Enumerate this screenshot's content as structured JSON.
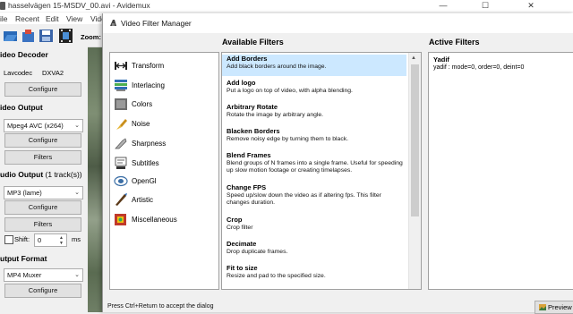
{
  "main": {
    "title": "hasselvägen 15-MSDV_00.avi - Avidemux",
    "menu": [
      "ile",
      "Recent",
      "Edit",
      "View",
      "Vide"
    ],
    "zoom_label": "Zoom:",
    "video_decoder": {
      "title": "ideo Decoder",
      "decoder_name": "Lavcodec",
      "decoder_codec": "DXVA2",
      "configure_label": "Configure"
    },
    "video_output": {
      "title": "ideo Output",
      "codec": "Mpeg4 AVC (x264)",
      "configure_label": "Configure",
      "filters_label": "Filters"
    },
    "audio_output": {
      "title": "udio Output",
      "tracks": "(1 track(s))",
      "codec": "MP3 (lame)",
      "configure_label": "Configure",
      "filters_label": "Filters",
      "shift_label": "Shift:",
      "shift_value": "0",
      "shift_unit": "ms"
    },
    "output_format": {
      "title": "utput Format",
      "muxer": "MP4 Muxer",
      "configure_label": "Configure"
    }
  },
  "dialog": {
    "title": "Video Filter Manager",
    "available_heading": "Available Filters",
    "active_heading": "Active Filters",
    "categories": [
      "Transform",
      "Interlacing",
      "Colors",
      "Noise",
      "Sharpness",
      "Subtitles",
      "OpenGl",
      "Artistic",
      "Miscellaneous"
    ],
    "available_filters": [
      {
        "name": "Add Borders",
        "desc": "Add black borders around the image."
      },
      {
        "name": "Add logo",
        "desc": "Put a logo on top of video, with alpha blending."
      },
      {
        "name": "Arbitrary Rotate",
        "desc": "Rotate the image by arbitrary angle."
      },
      {
        "name": "Blacken Borders",
        "desc": "Remove noisy edge by turning them to black."
      },
      {
        "name": "Blend Frames",
        "desc": "Blend groups of N frames into a single frame.  Useful for speeding up slow motion footage or creating timelapses."
      },
      {
        "name": "Change FPS",
        "desc": "Speed up/slow down the video as if altering fps. This filter changes duration."
      },
      {
        "name": "Crop",
        "desc": "Crop filter"
      },
      {
        "name": "Decimate",
        "desc": "Drop duplicate frames."
      },
      {
        "name": "Fit to size",
        "desc": "Resize and pad to the specified size."
      }
    ],
    "active_filters": [
      {
        "name": "Yadif",
        "desc": "yadif : mode=0, order=0, deint=0"
      }
    ],
    "hint": "Press Ctrl+Return to accept the dialog",
    "preview_label": "Preview"
  },
  "colors": {
    "selection": "#cce8ff",
    "button_face": "#e1e1e1"
  }
}
